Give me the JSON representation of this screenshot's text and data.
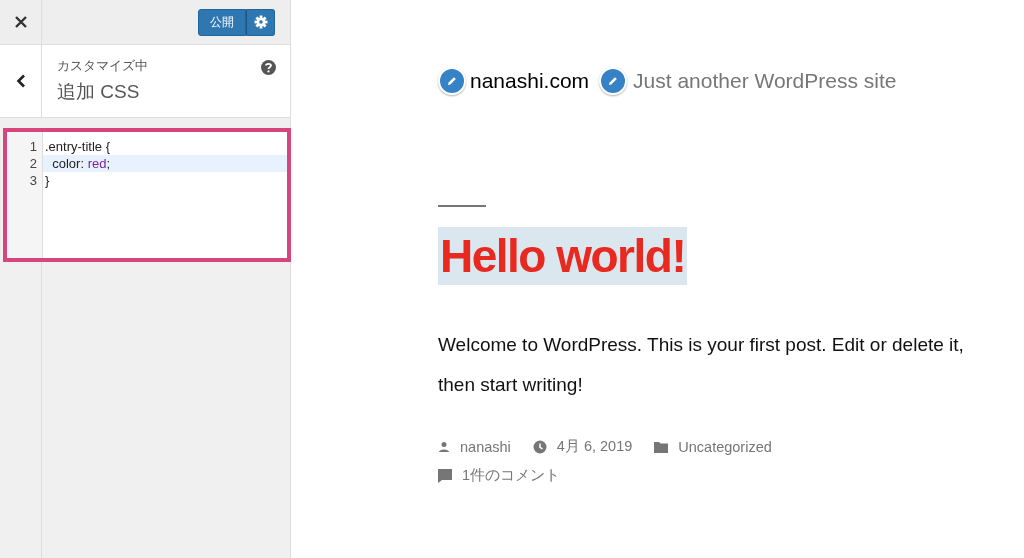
{
  "sidebar": {
    "publish_button": "公開",
    "section_label": "カスタマイズ中",
    "section_title": "追加 CSS",
    "code_lines": [
      {
        "number": "1",
        "active": false,
        "tokens": [
          {
            "kind": "plain",
            "text": ".entry-title {"
          }
        ]
      },
      {
        "number": "2",
        "active": true,
        "tokens": [
          {
            "kind": "plain",
            "text": "  color: "
          },
          {
            "kind": "keyword",
            "text": "red"
          },
          {
            "kind": "plain",
            "text": ";"
          }
        ]
      },
      {
        "number": "3",
        "active": false,
        "tokens": [
          {
            "kind": "plain",
            "text": "}"
          }
        ]
      }
    ]
  },
  "preview": {
    "site_title": "nanashi.com",
    "tagline": "Just another WordPress site",
    "post_title": "Hello world!",
    "post_body": "Welcome to WordPress. This is your first post. Edit or delete it, then start writing!",
    "meta": {
      "author": "nanashi",
      "date": "4月 6, 2019",
      "category": "Uncategorized",
      "comments": "1件のコメント"
    }
  }
}
